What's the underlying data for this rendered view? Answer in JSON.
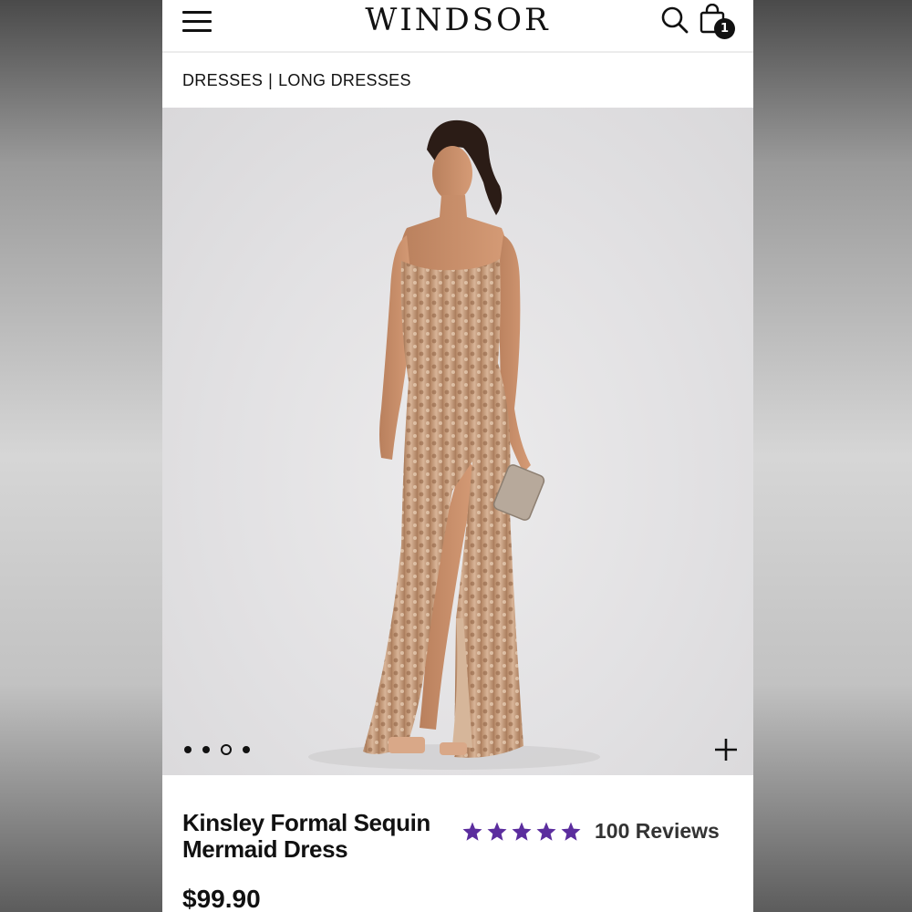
{
  "header": {
    "logo_text": "WINDSOR",
    "cart_count": "1",
    "icons": [
      "menu-icon",
      "search-icon",
      "shopping-bag-icon"
    ]
  },
  "breadcrumb": {
    "items": [
      "DRESSES",
      "LONG DRESSES"
    ],
    "separator": "|"
  },
  "gallery": {
    "image_count": 4,
    "active_index": 2,
    "zoom_icon": "plus-icon"
  },
  "product": {
    "title_line1": "Kinsley Formal Sequin",
    "title_line2": "Mermaid Dress",
    "rating": 5,
    "reviews_label": "100 Reviews",
    "price": "$99.90"
  },
  "colors": {
    "star": "#5b2d9e",
    "text": "#111111",
    "hero_bg": "#e4e3e5",
    "dress": "#c89f7e"
  }
}
